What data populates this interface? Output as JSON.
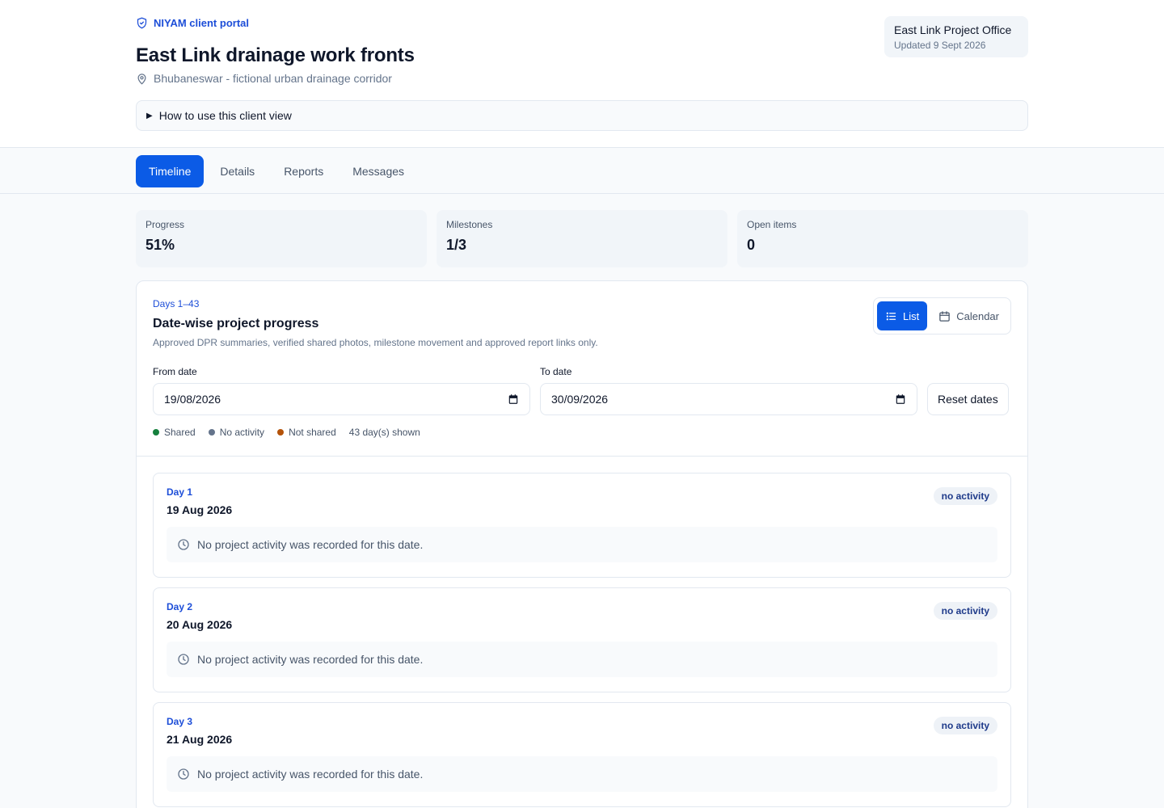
{
  "header": {
    "brand": "NIYAM client portal",
    "title": "East Link drainage work fronts",
    "location": "Bhubaneswar - fictional urban drainage corridor",
    "office_name": "East Link Project Office",
    "office_updated": "Updated 9 Sept 2026",
    "howto": "How to use this client view"
  },
  "tabs": [
    {
      "label": "Timeline"
    },
    {
      "label": "Details"
    },
    {
      "label": "Reports"
    },
    {
      "label": "Messages"
    }
  ],
  "stats": [
    {
      "label": "Progress",
      "value": "51%"
    },
    {
      "label": "Milestones",
      "value": "1/3"
    },
    {
      "label": "Open items",
      "value": "0"
    }
  ],
  "panel": {
    "eyebrow": "Days 1–43",
    "title": "Date-wise project progress",
    "description": "Approved DPR summaries, verified shared photos, milestone movement and approved report links only.",
    "view_list": "List",
    "view_calendar": "Calendar",
    "from_label": "From date",
    "from_value": "19/08/2026",
    "to_label": "To date",
    "to_value": "30/09/2026",
    "reset": "Reset dates",
    "legend": {
      "shared": "Shared",
      "no_activity": "No activity",
      "not_shared": "Not shared",
      "count": "43 day(s) shown"
    }
  },
  "colors": {
    "accent": "#0b5be6",
    "shared": "#15803d",
    "no_activity": "#64748b",
    "not_shared": "#b45309"
  },
  "days": [
    {
      "day": "Day 1",
      "date": "19 Aug 2026",
      "status": "no activity",
      "note": "No project activity was recorded for this date."
    },
    {
      "day": "Day 2",
      "date": "20 Aug 2026",
      "status": "no activity",
      "note": "No project activity was recorded for this date."
    },
    {
      "day": "Day 3",
      "date": "21 Aug 2026",
      "status": "no activity",
      "note": "No project activity was recorded for this date."
    }
  ]
}
